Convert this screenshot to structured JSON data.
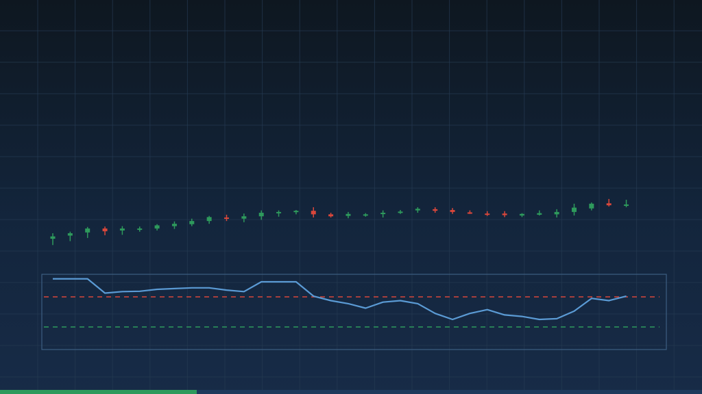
{
  "colors": {
    "up": "#2e9a5c",
    "down": "#d9473b",
    "rsi_line": "#5b9bd5",
    "overbought_line": "#d9473b",
    "oversold_line": "#2e9a5c",
    "grid": "#253a52",
    "panel_border": "#3d5e82",
    "progress": "#2e9a5c"
  },
  "progress": {
    "value": 0.28
  },
  "chart_data": [
    {
      "type": "candlestick",
      "panel": "price",
      "grid": true,
      "ylim": [
        0,
        100
      ],
      "candles": [
        {
          "o": 39.4,
          "h": 40.8,
          "l": 37.8,
          "c": 40.0
        },
        {
          "o": 40.2,
          "h": 41.2,
          "l": 38.8,
          "c": 40.8
        },
        {
          "o": 41.0,
          "h": 42.4,
          "l": 39.6,
          "c": 42.0
        },
        {
          "o": 42.0,
          "h": 42.5,
          "l": 40.3,
          "c": 41.3
        },
        {
          "o": 41.5,
          "h": 42.6,
          "l": 40.4,
          "c": 42.0
        },
        {
          "o": 41.8,
          "h": 42.5,
          "l": 41.2,
          "c": 42.0
        },
        {
          "o": 42.0,
          "h": 43.1,
          "l": 41.5,
          "c": 42.8
        },
        {
          "o": 42.6,
          "h": 43.8,
          "l": 41.9,
          "c": 43.2
        },
        {
          "o": 43.1,
          "h": 44.5,
          "l": 42.6,
          "c": 43.9
        },
        {
          "o": 43.9,
          "h": 45.2,
          "l": 43.2,
          "c": 44.9
        },
        {
          "o": 44.8,
          "h": 45.5,
          "l": 43.9,
          "c": 44.5
        },
        {
          "o": 44.5,
          "h": 45.8,
          "l": 43.6,
          "c": 45.1
        },
        {
          "o": 45.1,
          "h": 46.6,
          "l": 44.2,
          "c": 46.0
        },
        {
          "o": 45.9,
          "h": 46.6,
          "l": 45.0,
          "c": 46.2
        },
        {
          "o": 46.2,
          "h": 46.7,
          "l": 45.6,
          "c": 46.5
        },
        {
          "o": 46.5,
          "h": 47.4,
          "l": 44.8,
          "c": 45.6
        },
        {
          "o": 45.6,
          "h": 46.0,
          "l": 44.8,
          "c": 45.1
        },
        {
          "o": 45.2,
          "h": 46.2,
          "l": 44.6,
          "c": 45.7
        },
        {
          "o": 45.4,
          "h": 45.9,
          "l": 45.0,
          "c": 45.6
        },
        {
          "o": 45.7,
          "h": 46.6,
          "l": 44.8,
          "c": 46.0
        },
        {
          "o": 46.0,
          "h": 46.7,
          "l": 45.7,
          "c": 46.3
        },
        {
          "o": 46.6,
          "h": 47.4,
          "l": 46.0,
          "c": 47.0
        },
        {
          "o": 46.9,
          "h": 47.4,
          "l": 46.0,
          "c": 46.5
        },
        {
          "o": 46.7,
          "h": 47.2,
          "l": 45.7,
          "c": 46.2
        },
        {
          "o": 46.1,
          "h": 46.6,
          "l": 45.7,
          "c": 45.8
        },
        {
          "o": 45.8,
          "h": 46.4,
          "l": 45.2,
          "c": 45.6
        },
        {
          "o": 45.8,
          "h": 46.4,
          "l": 44.9,
          "c": 45.4
        },
        {
          "o": 45.3,
          "h": 45.9,
          "l": 44.9,
          "c": 45.7
        },
        {
          "o": 45.5,
          "h": 46.6,
          "l": 45.3,
          "c": 45.9
        },
        {
          "o": 45.6,
          "h": 46.9,
          "l": 44.8,
          "c": 46.2
        },
        {
          "o": 46.2,
          "h": 48.3,
          "l": 45.3,
          "c": 47.3
        },
        {
          "o": 47.1,
          "h": 48.6,
          "l": 46.6,
          "c": 48.3
        },
        {
          "o": 48.4,
          "h": 49.5,
          "l": 47.6,
          "c": 47.9
        },
        {
          "o": 47.8,
          "h": 49.3,
          "l": 47.4,
          "c": 48.1
        }
      ]
    },
    {
      "type": "line",
      "panel": "rsi",
      "ylim": [
        0,
        100
      ],
      "reference_lines": [
        70,
        30
      ],
      "values": [
        94,
        94,
        94,
        75,
        77,
        77.5,
        80,
        81,
        82,
        82,
        79,
        77,
        90,
        90,
        90,
        71,
        65,
        61,
        55,
        63,
        65,
        61,
        48,
        40,
        48,
        53,
        46,
        44,
        40,
        41,
        51,
        68,
        65,
        71
      ]
    }
  ]
}
